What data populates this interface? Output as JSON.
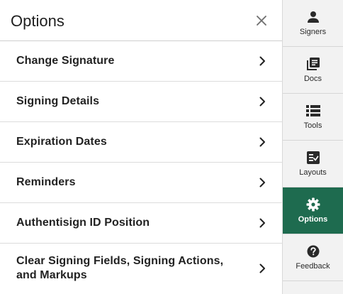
{
  "panel": {
    "title": "Options",
    "items": [
      {
        "label": "Change Signature"
      },
      {
        "label": "Signing Details"
      },
      {
        "label": "Expiration Dates"
      },
      {
        "label": "Reminders"
      },
      {
        "label": "Authentisign ID Position"
      },
      {
        "label": "Clear Signing Fields, Signing Actions, and Markups"
      }
    ]
  },
  "sidebar": {
    "items": [
      {
        "label": "Signers",
        "icon": "person-icon"
      },
      {
        "label": "Docs",
        "icon": "documents-icon"
      },
      {
        "label": "Tools",
        "icon": "list-icon"
      },
      {
        "label": "Layouts",
        "icon": "checklist-icon"
      },
      {
        "label": "Options",
        "icon": "gear-icon",
        "active": true
      },
      {
        "label": "Feedback",
        "icon": "help-icon"
      }
    ]
  },
  "colors": {
    "active_bg": "#1e6b4f",
    "sidebar_bg": "#f2f2f2"
  }
}
